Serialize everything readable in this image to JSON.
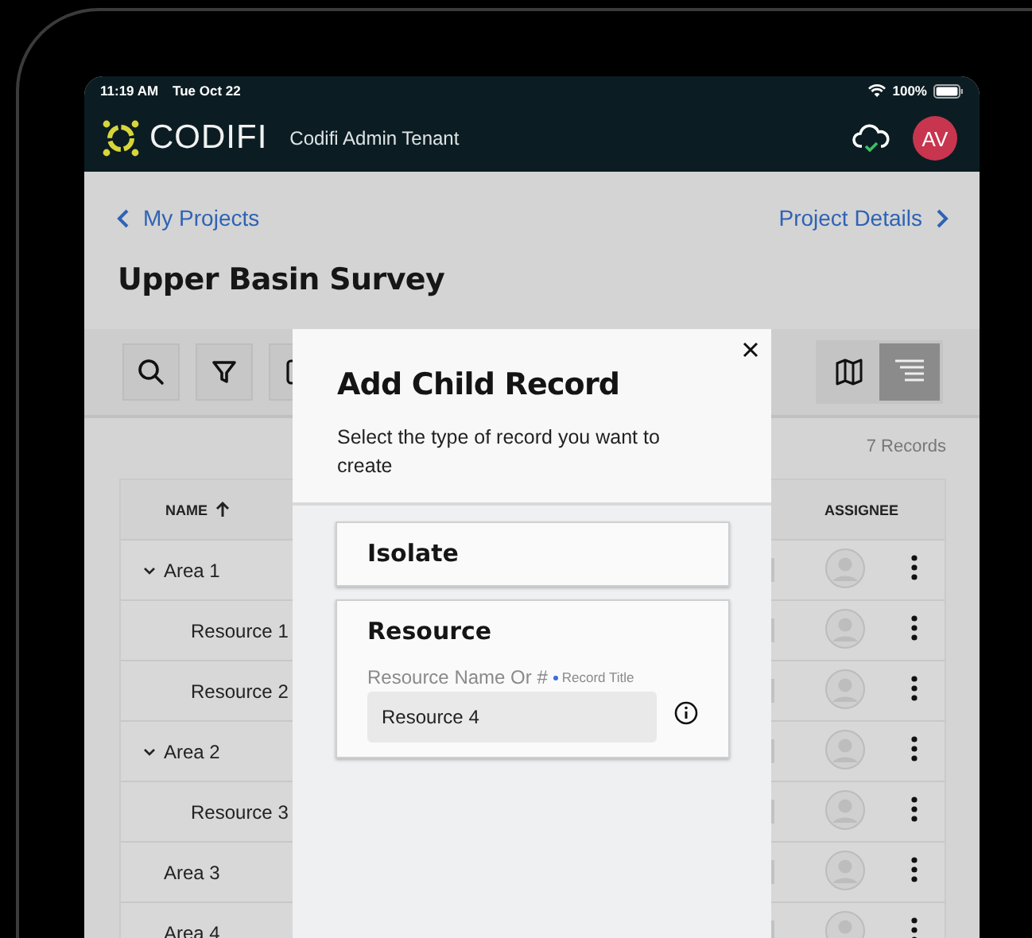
{
  "status_bar": {
    "time": "11:19 AM",
    "date": "Tue Oct 22",
    "battery": "100%"
  },
  "header": {
    "brand": "CODIFI",
    "tenant": "Codifi Admin Tenant",
    "avatar": "AV"
  },
  "nav": {
    "back": "My Projects",
    "forward": "Project Details"
  },
  "title": "Upper Basin Survey",
  "toolbar": {
    "tools": [
      {
        "kind": "search"
      },
      {
        "kind": "filter"
      },
      {
        "kind": "other"
      }
    ],
    "views": [
      {
        "kind": "map",
        "selected": false
      },
      {
        "kind": "list",
        "selected": true
      }
    ]
  },
  "record_count": "7 Records",
  "table": {
    "columns": [
      {
        "label": "NAME",
        "sort_ascending": true
      },
      {
        "label": "ASSIGNEE"
      }
    ],
    "rows": [
      {
        "name": "Area 1",
        "expanded": true,
        "children": [
          {
            "name": "Resource 1"
          },
          {
            "name": "Resource 2"
          }
        ]
      },
      {
        "name": "Area 2",
        "expanded": true,
        "children": [
          {
            "name": "Resource 3"
          }
        ]
      },
      {
        "name": "Area 3"
      },
      {
        "name": "Area 4"
      }
    ]
  },
  "dialog": {
    "title": "Add Child Record",
    "subtitle": "Select the type of record you want to create",
    "options": [
      {
        "kind": "option",
        "label": "Isolate"
      },
      {
        "kind": "form",
        "label": "Resource",
        "field": {
          "label": "Resource Name Or #",
          "hint": "Record Title",
          "value": "Resource 4"
        }
      }
    ]
  }
}
